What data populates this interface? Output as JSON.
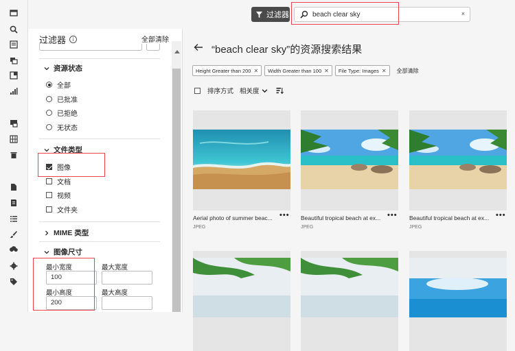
{
  "rail": {
    "icons": [
      "home-icon",
      "search-icon",
      "list-icon",
      "folder-image-icon",
      "export-icon",
      "bar-chart-icon",
      "image-gallery-icon",
      "grid-icon",
      "trash-icon",
      "document-icon",
      "report-icon",
      "task-list-icon",
      "brush-icon",
      "upload-icon",
      "settings-icon",
      "tags-icon"
    ]
  },
  "topbar": {
    "filter_label": "过滤器",
    "search_value": "beach clear sky",
    "clear_glyph": "×"
  },
  "filters": {
    "title": "过滤器",
    "info_glyph": "i",
    "clear_all": "全部清除",
    "asset_status": {
      "title": "资源状态",
      "options": [
        {
          "label": "全部",
          "selected": true
        },
        {
          "label": "已批准",
          "selected": false
        },
        {
          "label": "已拒绝",
          "selected": false
        },
        {
          "label": "无状态",
          "selected": false
        }
      ]
    },
    "file_type": {
      "title": "文件类型",
      "options": [
        {
          "label": "图像",
          "checked": true
        },
        {
          "label": "文档",
          "checked": false
        },
        {
          "label": "视频",
          "checked": false
        },
        {
          "label": "文件夹",
          "checked": false
        }
      ]
    },
    "mime": {
      "title": "MIME 类型"
    },
    "image_size": {
      "title": "图像尺寸",
      "min_width_label": "最小宽度",
      "max_width_label": "最大宽度",
      "min_width_value": "100",
      "max_width_value": "",
      "min_height_label": "最小高度",
      "max_height_label": "最大高度",
      "min_height_value": "200",
      "max_height_value": ""
    }
  },
  "main": {
    "title": "“beach clear sky”的资源搜索结果",
    "chips": [
      {
        "label": "Height Greater than 200"
      },
      {
        "label": "Width Greater than 100"
      },
      {
        "label": "File Type: Images"
      }
    ],
    "chip_clear_all": "全部清除",
    "sort_label": "排序方式",
    "sort_value": "相关度",
    "cards": [
      {
        "name": "Aerial photo of summer beac...",
        "type": "JPEG",
        "more": "•••"
      },
      {
        "name": "Beautiful tropical beach at ex...",
        "type": "JPEG",
        "more": "•••"
      },
      {
        "name": "Beautiful tropical beach at ex...",
        "type": "JPEG",
        "more": "•••"
      }
    ]
  },
  "colors": {
    "highlight": "#e8444d",
    "dark_button": "#4a4a4a"
  }
}
